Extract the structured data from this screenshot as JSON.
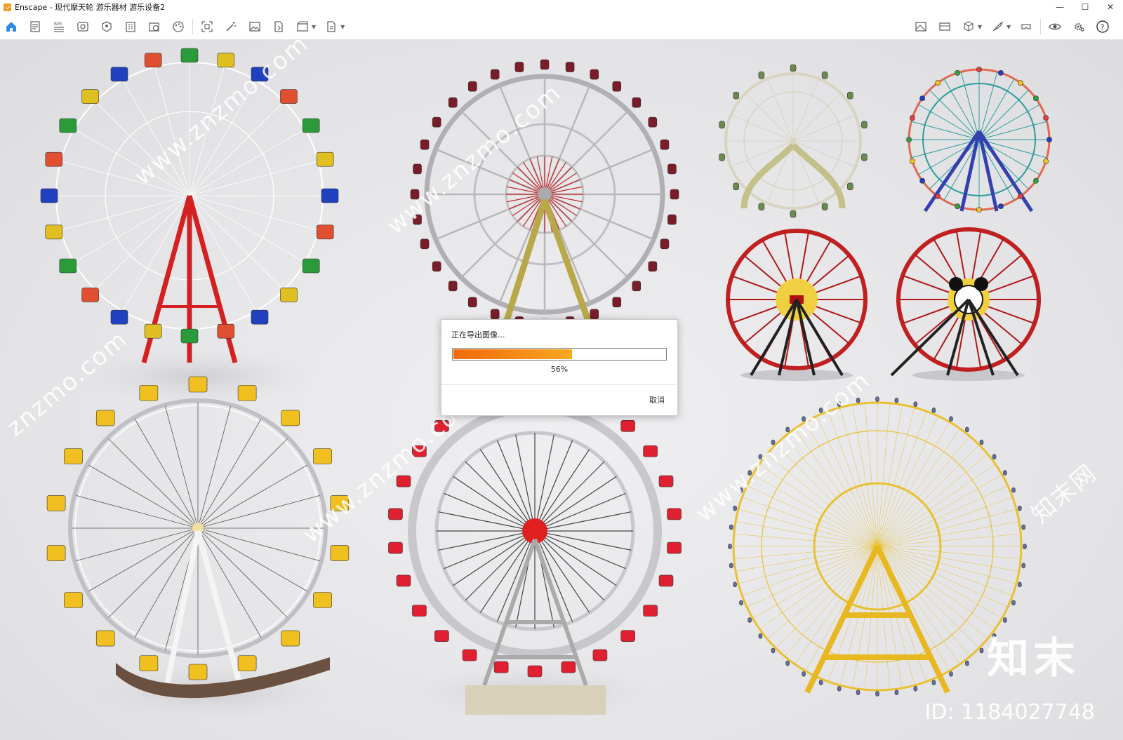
{
  "window": {
    "title": "Enscape - 现代摩天轮 游乐器材 游乐设备2",
    "controls": {
      "minimize": "—",
      "maximize": "☐",
      "close": "✕"
    }
  },
  "toolbar": {
    "left_icons": [
      "home-icon",
      "document-icon",
      "bim-icon",
      "view-icon",
      "asset-icon",
      "building-icon",
      "camera-export-icon",
      "palette-icon",
      "screenshot-icon",
      "magic-wand-icon",
      "image-icon",
      "file-export-icon",
      "video-icon",
      "batch-export-icon"
    ],
    "right_icons": [
      "map-icon",
      "panorama-icon",
      "cube-icon",
      "feather-icon",
      "vr-headset-icon",
      "eye-icon",
      "settings-icon",
      "help-icon"
    ],
    "help_label": "?"
  },
  "viewport": {
    "watermark": {
      "site": "www.znzmo.com",
      "site_short": "znzmo.com",
      "brand": "知末网",
      "logo": "知末",
      "id": "ID: 1184027748"
    }
  },
  "dialog": {
    "title": "正在导出图像...",
    "progress_percent": 56,
    "progress_label": "56%",
    "cancel_label": "取消"
  },
  "colors": {
    "progress_start": "#f06a0a",
    "progress_end": "#f9a81f",
    "accent_home": "#2b8be6"
  }
}
